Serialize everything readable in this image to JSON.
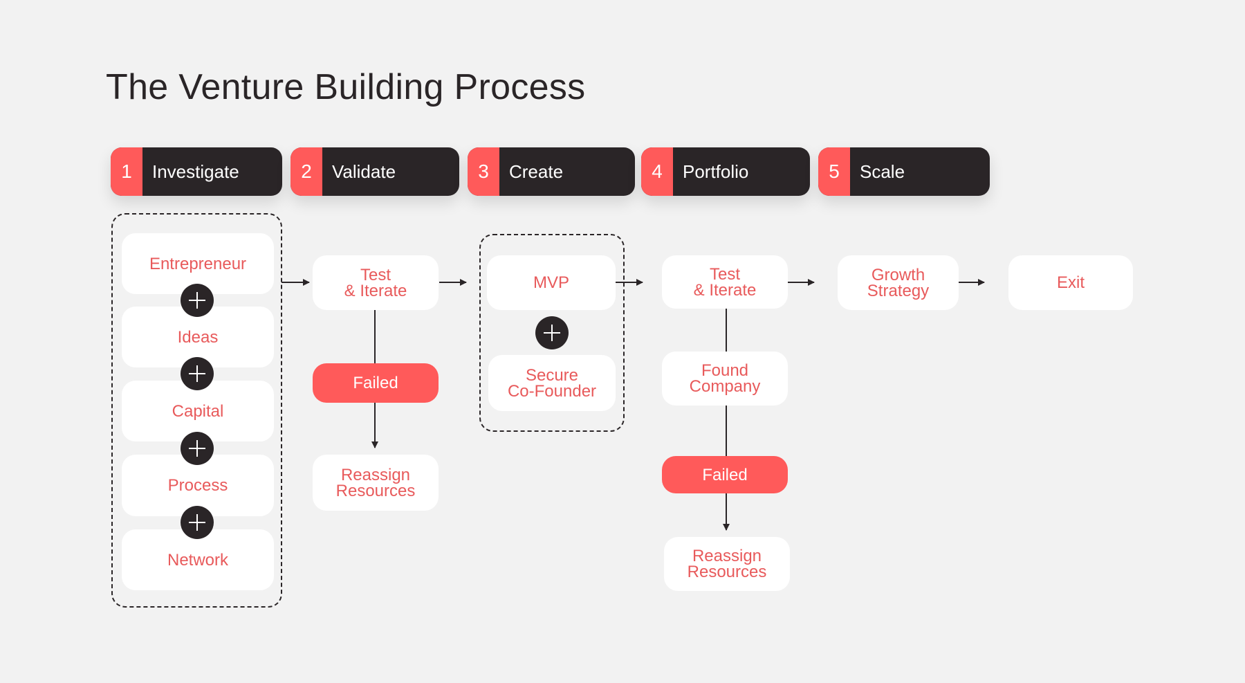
{
  "title": "The Venture Building Process",
  "colors": {
    "accent": "#FF5A5A",
    "dark": "#2A2527",
    "card_text": "#E85A5B",
    "background": "#F2F2F2",
    "card": "#FFFFFF"
  },
  "stages": [
    {
      "number": "1",
      "label": "Investigate"
    },
    {
      "number": "2",
      "label": "Validate"
    },
    {
      "number": "3",
      "label": "Create"
    },
    {
      "number": "4",
      "label": "Portfolio"
    },
    {
      "number": "5",
      "label": "Scale"
    }
  ],
  "investigate": {
    "items": [
      "Entrepreneur",
      "Ideas",
      "Capital",
      "Process",
      "Network"
    ],
    "connector_icon": "plus-icon"
  },
  "validate": {
    "test": "Test\n& Iterate",
    "failed": "Failed",
    "reassign": "Reassign\nResources"
  },
  "create": {
    "mvp": "MVP",
    "cofounder": "Secure\nCo-Founder",
    "connector_icon": "plus-icon"
  },
  "portfolio": {
    "test": "Test\n& Iterate",
    "found": "Found\nCompany",
    "failed": "Failed",
    "reassign": "Reassign\nResources"
  },
  "scale": {
    "growth": "Growth\nStrategy",
    "exit": "Exit"
  }
}
